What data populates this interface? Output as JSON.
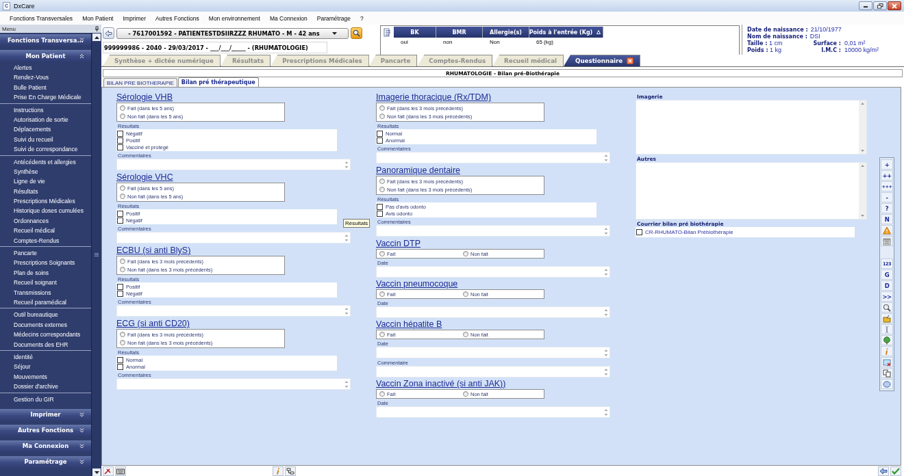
{
  "window": {
    "app_icon": "C",
    "title": "DxCare"
  },
  "menu_bar": [
    "Fonctions Transversales",
    "Mon Patient",
    "Imprimer",
    "Autres Fonctions",
    "Mon environnement",
    "Ma Connexion",
    "Paramétrage",
    "?"
  ],
  "sidebar": {
    "title": "Menu",
    "sections": [
      {
        "label": "Fonctions Transversa...",
        "expanded": false
      },
      {
        "label": "Mon Patient",
        "expanded": true,
        "groups": [
          [
            "Alertes",
            "Rendez-Vous",
            "Bulle Patient",
            "Prise En Charge Médicale"
          ],
          [
            "Instructions",
            "Autorisation de sortie",
            "Déplacements",
            "Suivi du recueil",
            "Suivi de correspondance"
          ],
          [
            "Antécédents et allergies",
            "Synthèse",
            "Ligne de vie",
            "Résultats",
            "Prescriptions Médicales",
            "Historique doses cumulées",
            "Ordonnances",
            "Recueil médical",
            "Comptes-Rendus"
          ],
          [
            "Pancarte",
            "Prescriptions Soignants",
            "Plan de soins",
            "Recueil soignant",
            "Transmissions",
            "Recueil paramédical"
          ],
          [
            "Outil bureautique",
            "Documents externes",
            "Médecins correspondants",
            "Documents des EHR"
          ],
          [
            "Identité",
            "Séjour",
            "Mouvements",
            "Dossier d'archive"
          ],
          [
            "Gestion du GIR"
          ]
        ]
      },
      {
        "label": "Imprimer",
        "expanded": false
      },
      {
        "label": "Autres Fonctions",
        "expanded": false
      },
      {
        "label": "Ma Connexion",
        "expanded": false
      },
      {
        "label": "Paramétrage",
        "expanded": false
      }
    ]
  },
  "patient": {
    "selector": "- 7617001592 - PATIENTESTDSIIRZZZ RHUMATO - M - 42 ans",
    "stay": "999999986 - 2040 - 29/03/2017 - ___/___/_____ - (RHUMATOLOGIE)"
  },
  "alerts": {
    "columns": [
      "BK",
      "BMR",
      "Allergie(s)",
      "Poids à l'entrée (Kg)"
    ],
    "values": [
      "oui",
      "non",
      "Non",
      "65 (kg)"
    ]
  },
  "identity": [
    {
      "label": "Date de naissance :",
      "value": "21/10/1977"
    },
    {
      "label": "Nom de naissance :",
      "value": "DSI"
    },
    {
      "label": "Taille :",
      "value": "1 cm"
    },
    {
      "label": "Surface :",
      "value": "0,01 m²"
    },
    {
      "label": "Poids :",
      "value": "1 kg"
    },
    {
      "label": "I.M.C :",
      "value": "10000 kg/m²"
    }
  ],
  "tabs": [
    {
      "label": "Synthèse + dictée numérique",
      "selected": false,
      "closable": false
    },
    {
      "label": "Résultats",
      "selected": false,
      "closable": false
    },
    {
      "label": "Prescriptions Médicales",
      "selected": false,
      "closable": false
    },
    {
      "label": "Pancarte",
      "selected": false,
      "closable": false
    },
    {
      "label": "Comptes-Rendus",
      "selected": false,
      "closable": false
    },
    {
      "label": "Recueil médical",
      "selected": false,
      "closable": false
    },
    {
      "label": "Questionnaire",
      "selected": true,
      "closable": true
    }
  ],
  "form": {
    "title": "RHUMATOLOGIE - Bilan pré-Biothérapie",
    "sub_tabs": [
      {
        "label": "BILAN PRE BIOTHERAPIE",
        "selected": false
      },
      {
        "label": "Bilan pré thérapeutique",
        "selected": true
      }
    ],
    "columns": [
      [
        {
          "kind": "stacked",
          "title": "Sérologie VHB",
          "choices": [
            {
              "label": "Fait (dans les 5 ans)",
              "selected": false
            },
            {
              "label": "Non fait (dans les 5 ans)",
              "selected": false
            }
          ],
          "results_label": "Résultats",
          "results": [
            {
              "label": "Négatif",
              "checked": false
            },
            {
              "label": "Positif",
              "checked": false
            },
            {
              "label": "Vacciné et protegé",
              "checked": false
            }
          ],
          "fields": [
            "Commentaires"
          ]
        },
        {
          "kind": "stacked",
          "title": "Sérologie VHC",
          "choices": [
            {
              "label": "Fait (dans les 5 ans)",
              "selected": false
            },
            {
              "label": "Non fait (dans les 5 ans)",
              "selected": false
            }
          ],
          "results_label": "Résultats",
          "results": [
            {
              "label": "Positif",
              "checked": false
            },
            {
              "label": "Négatif",
              "checked": false
            }
          ],
          "fields": [
            "Commentaires"
          ]
        },
        {
          "kind": "stacked",
          "title": "ECBU (si anti BlyS)",
          "choices": [
            {
              "label": "Fait (dans les 3 mois précédents)",
              "selected": false
            },
            {
              "label": "Non fait (dans les 3 mois précédents)",
              "selected": false
            }
          ],
          "results_label": "Résultats",
          "results": [
            {
              "label": "Positif",
              "checked": false
            },
            {
              "label": "Négatif",
              "checked": false
            }
          ],
          "fields": [
            "Commentaires"
          ]
        },
        {
          "kind": "stacked",
          "title": "ECG (si anti CD20)",
          "choices": [
            {
              "label": "Fait (dans les 3 mois précédents)",
              "selected": false
            },
            {
              "label": "Non fait (dans les 3 mois précédents)",
              "selected": false
            }
          ],
          "results_label": "Résultats",
          "results": [
            {
              "label": "Normal",
              "checked": false
            },
            {
              "label": "Anormal",
              "checked": false
            }
          ],
          "fields": [
            "Commentaires"
          ]
        }
      ],
      [
        {
          "kind": "stacked",
          "title": "Imagerie thoracique (Rx/TDM)",
          "choices": [
            {
              "label": "Fait (dans les 3 mois précédents)",
              "selected": false
            },
            {
              "label": "Non fait (dans les 3 mois précédents)",
              "selected": false
            }
          ],
          "results_label": "Résultats",
          "results": [
            {
              "label": "Normal",
              "checked": false
            },
            {
              "label": "Anormal",
              "checked": false
            }
          ],
          "fields": [
            "Commentaires"
          ]
        },
        {
          "kind": "stacked",
          "title": "Panoramique dentaire",
          "choices": [
            {
              "label": "Fait (dans les 3 mois précédents)",
              "selected": false
            },
            {
              "label": "Non fait (dans les 3 mois précédents)",
              "selected": false
            }
          ],
          "results_label": "Résultats",
          "results": [
            {
              "label": "Pas d'avis odonto",
              "checked": false
            },
            {
              "label": "Avis odonto",
              "checked": false
            }
          ],
          "fields": [
            "Commentaires"
          ]
        },
        {
          "kind": "inline",
          "title": "Vaccin DTP",
          "choices": [
            {
              "label": "Fait",
              "selected": false
            },
            {
              "label": "Non fait",
              "selected": false
            }
          ],
          "fields": [
            "Date"
          ]
        },
        {
          "kind": "inline",
          "title": "Vaccin pneumocoque",
          "choices": [
            {
              "label": "Fait",
              "selected": false
            },
            {
              "label": "Non fait",
              "selected": false
            }
          ],
          "fields": [
            "Date"
          ]
        },
        {
          "kind": "inline",
          "title": "Vaccin hépatite B",
          "choices": [
            {
              "label": "Fait",
              "selected": false
            },
            {
              "label": "Non fait",
              "selected": false
            }
          ],
          "fields": [
            "Date",
            "Commentaire"
          ]
        },
        {
          "kind": "inline",
          "title": "Vaccin Zona inactivé (si anti JAK))",
          "choices": [
            {
              "label": "Fait",
              "selected": false
            },
            {
              "label": "Non fait",
              "selected": false
            }
          ],
          "fields": [
            "Date"
          ]
        }
      ]
    ],
    "memos": [
      "Imagerie",
      "Autres"
    ],
    "letter": {
      "label": "Courrier bilan pré biothérapie",
      "options": [
        {
          "label": "CR-RHUMATO-Bilan Prébiothérapie",
          "checked": false
        }
      ]
    },
    "tooltip": "Résultats",
    "toolbar": {
      "group_1": [
        "+",
        "++",
        "+++",
        "-",
        "?",
        "N"
      ],
      "group_2": [
        "123",
        "G",
        "D",
        ">>"
      ]
    }
  }
}
